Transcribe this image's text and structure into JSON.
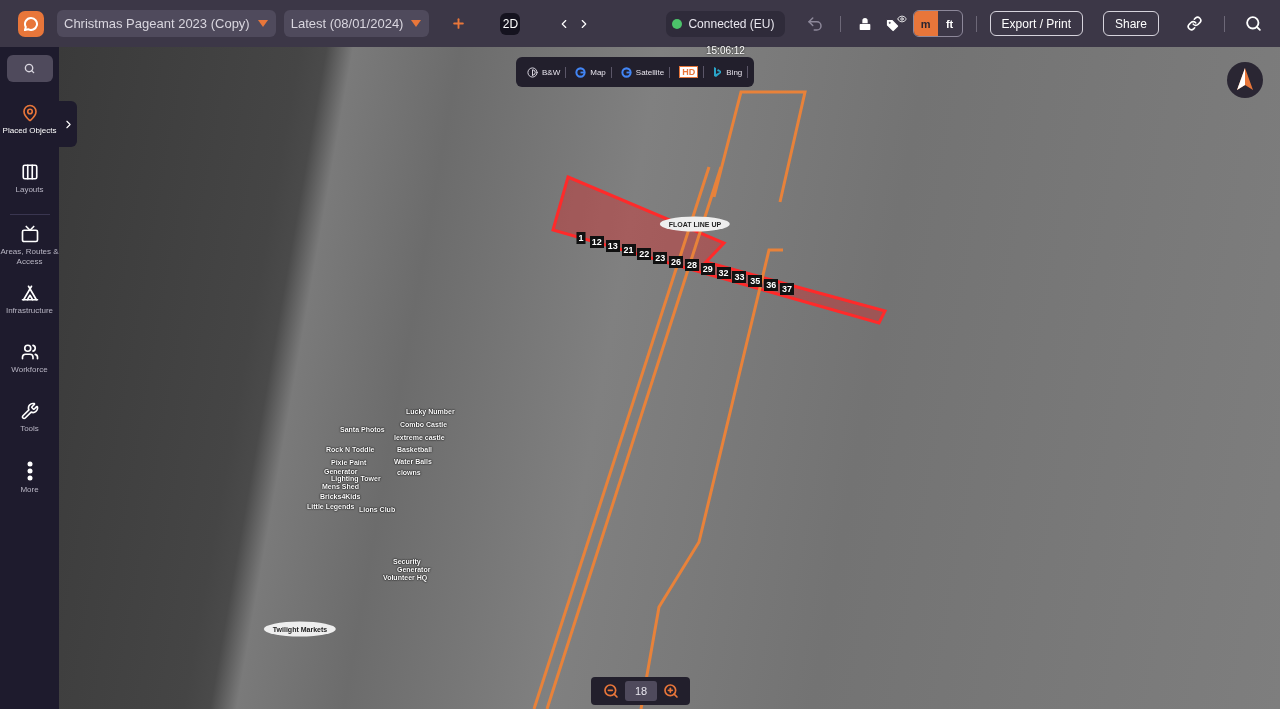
{
  "topbar": {
    "project_select": "Christmas Pageant 2023 (Copy)",
    "version_select": "Latest (08/01/2024)",
    "view_mode": "2D",
    "connection": {
      "label": "Connected (EU)"
    },
    "time": "15:06:12",
    "units": [
      {
        "label": "m",
        "selected": true
      },
      {
        "label": "ft",
        "selected": false
      }
    ],
    "buttons": [
      "Export / Print",
      "Share"
    ]
  },
  "sidebar": {
    "items": [
      {
        "label": "Placed Objects",
        "selected": true
      },
      {
        "label": "Layouts",
        "selected": false
      },
      {
        "label": "Areas, Routes & Access",
        "selected": false
      },
      {
        "label": "Infrastructure",
        "selected": false
      },
      {
        "label": "Workforce",
        "selected": false
      },
      {
        "label": "Tools",
        "selected": false
      },
      {
        "label": "More",
        "selected": false
      }
    ]
  },
  "map_sources": [
    "B&W",
    "Map",
    "Satellite",
    "HD",
    "Bing"
  ],
  "map_labels": [
    {
      "text": "FLOAT LINE UP",
      "kind": "pill"
    },
    {
      "text": "Twilight Markets",
      "kind": "pill"
    },
    {
      "text": "Lucky Number",
      "kind": "plain"
    },
    {
      "text": "Combo Castle",
      "kind": "plain"
    },
    {
      "text": "Iextreme castle",
      "kind": "plain"
    },
    {
      "text": "Basketball",
      "kind": "plain"
    },
    {
      "text": "Water Balls",
      "kind": "plain"
    },
    {
      "text": "clowns",
      "kind": "plain"
    },
    {
      "text": "Santa Photos",
      "kind": "plain"
    },
    {
      "text": "Rock N Toddle",
      "kind": "plain"
    },
    {
      "text": "Pixie Paint",
      "kind": "plain"
    },
    {
      "text": "Generator",
      "kind": "plain"
    },
    {
      "text": "Lighting Tower",
      "kind": "plain"
    },
    {
      "text": "Mens Shed",
      "kind": "plain"
    },
    {
      "text": "Bricks4Kids",
      "kind": "plain"
    },
    {
      "text": "Little Legends",
      "kind": "plain"
    },
    {
      "text": "Lions Club",
      "kind": "plain"
    },
    {
      "text": "Security",
      "kind": "plain"
    },
    {
      "text": "Generator",
      "kind": "plain"
    },
    {
      "text": "Volunteer HQ",
      "kind": "plain"
    }
  ],
  "float_numbers": [
    "1",
    "12",
    "13",
    "21",
    "22",
    "23",
    "26",
    "28",
    "29",
    "32",
    "33",
    "35",
    "36",
    "37"
  ],
  "zoom": "18"
}
